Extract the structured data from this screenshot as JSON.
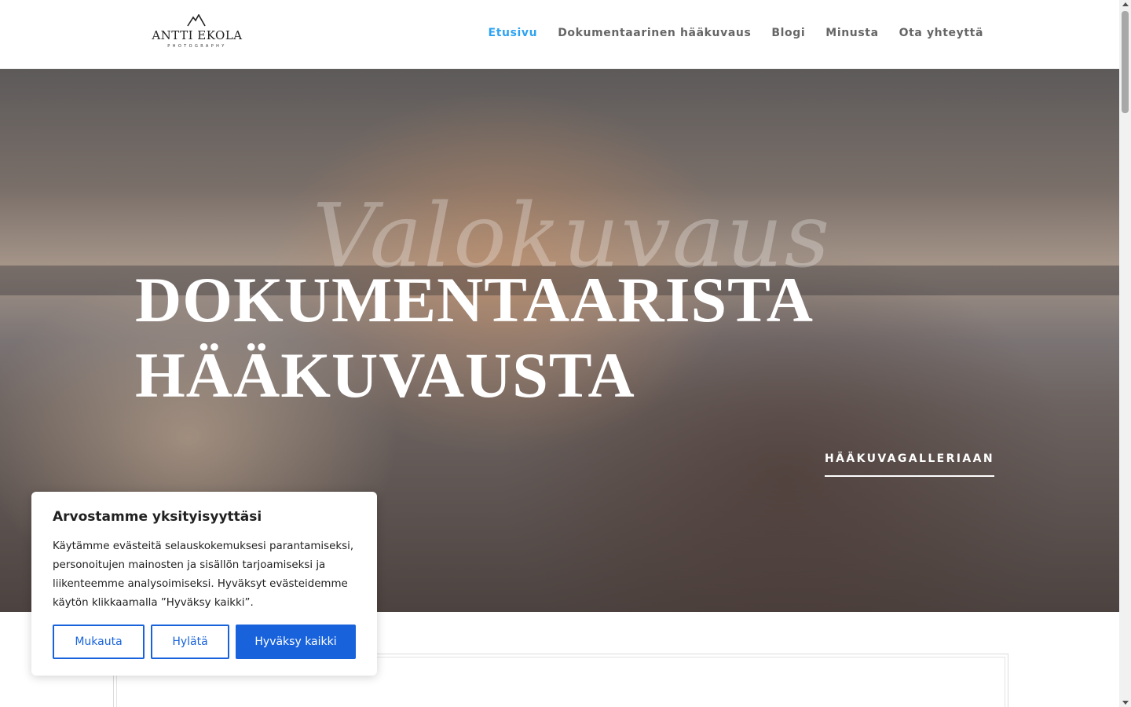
{
  "header": {
    "logo": {
      "name": "ANTTI EKOLA",
      "subtitle": "PHOTOGRAPHY"
    },
    "nav": [
      {
        "label": "Etusivu",
        "active": true
      },
      {
        "label": "Dokumentaarinen hääkuvaus",
        "active": false
      },
      {
        "label": "Blogi",
        "active": false
      },
      {
        "label": "Minusta",
        "active": false
      },
      {
        "label": "Ota yhteyttä",
        "active": false
      }
    ]
  },
  "hero": {
    "script_text": "Valokuvaus",
    "title_line1": "DOKUMENTAARISTA",
    "title_line2": "HÄÄKUVAUSTA",
    "cta_label": "HÄÄKUVAGALLERIAAN"
  },
  "cookie": {
    "title": "Arvostamme yksityisyyttäsi",
    "text": "Käytämme evästeitä selauskokemuksesi parantamiseksi, personoitujen mainosten ja sisällön tarjoamiseksi ja liikenteemme analysoimiseksi. Hyväksyt evästeidemme käytön klikkaamalla ”Hyväksy kaikki”.",
    "btn_customize": "Mukauta",
    "btn_reject": "Hylätä",
    "btn_accept": "Hyväksy kaikki"
  },
  "colors": {
    "nav_active": "#2ea3f2",
    "nav_default": "#666666",
    "cookie_primary": "#1863dc"
  }
}
